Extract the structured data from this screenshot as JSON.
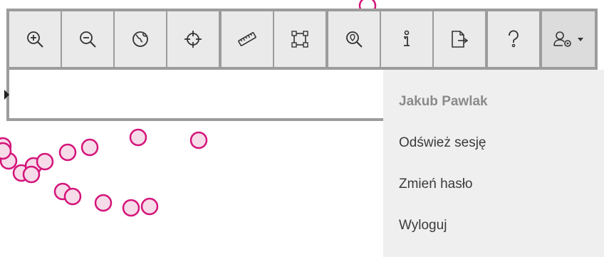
{
  "toolbar": {
    "groups": [
      [
        {
          "icon": "zoom-in-icon",
          "title": "Zoom in"
        },
        {
          "icon": "zoom-out-icon",
          "title": "Zoom out"
        },
        {
          "icon": "globe-icon",
          "title": "Full extent"
        },
        {
          "icon": "crosshair-icon",
          "title": "Locate"
        }
      ],
      [
        {
          "icon": "ruler-icon",
          "title": "Measure"
        },
        {
          "icon": "area-select-icon",
          "title": "Select area"
        }
      ],
      [
        {
          "icon": "search-location-icon",
          "title": "Search"
        },
        {
          "icon": "info-icon",
          "title": "Information"
        },
        {
          "icon": "export-icon",
          "title": "Export"
        }
      ],
      [
        {
          "icon": "help-icon",
          "title": "Help"
        }
      ]
    ],
    "user_button": {
      "icon": "user-settings-icon",
      "caret": "caret-down-icon"
    }
  },
  "search": {
    "value": "",
    "placeholder": ""
  },
  "user_menu": {
    "username": "Jakub Pawlak",
    "items": [
      {
        "name": "refresh-session",
        "label": "Odśwież sesję"
      },
      {
        "name": "change-password",
        "label": "Zmień hasło"
      },
      {
        "name": "logout",
        "label": "Wyloguj"
      }
    ]
  },
  "colors": {
    "marker_stroke": "#d4147a",
    "marker_fill": "#f6dce9",
    "toolbar_frame": "#9c9c9c",
    "button_bg": "#eaeaea",
    "menu_bg": "#efefef",
    "icon_color": "#333333"
  }
}
